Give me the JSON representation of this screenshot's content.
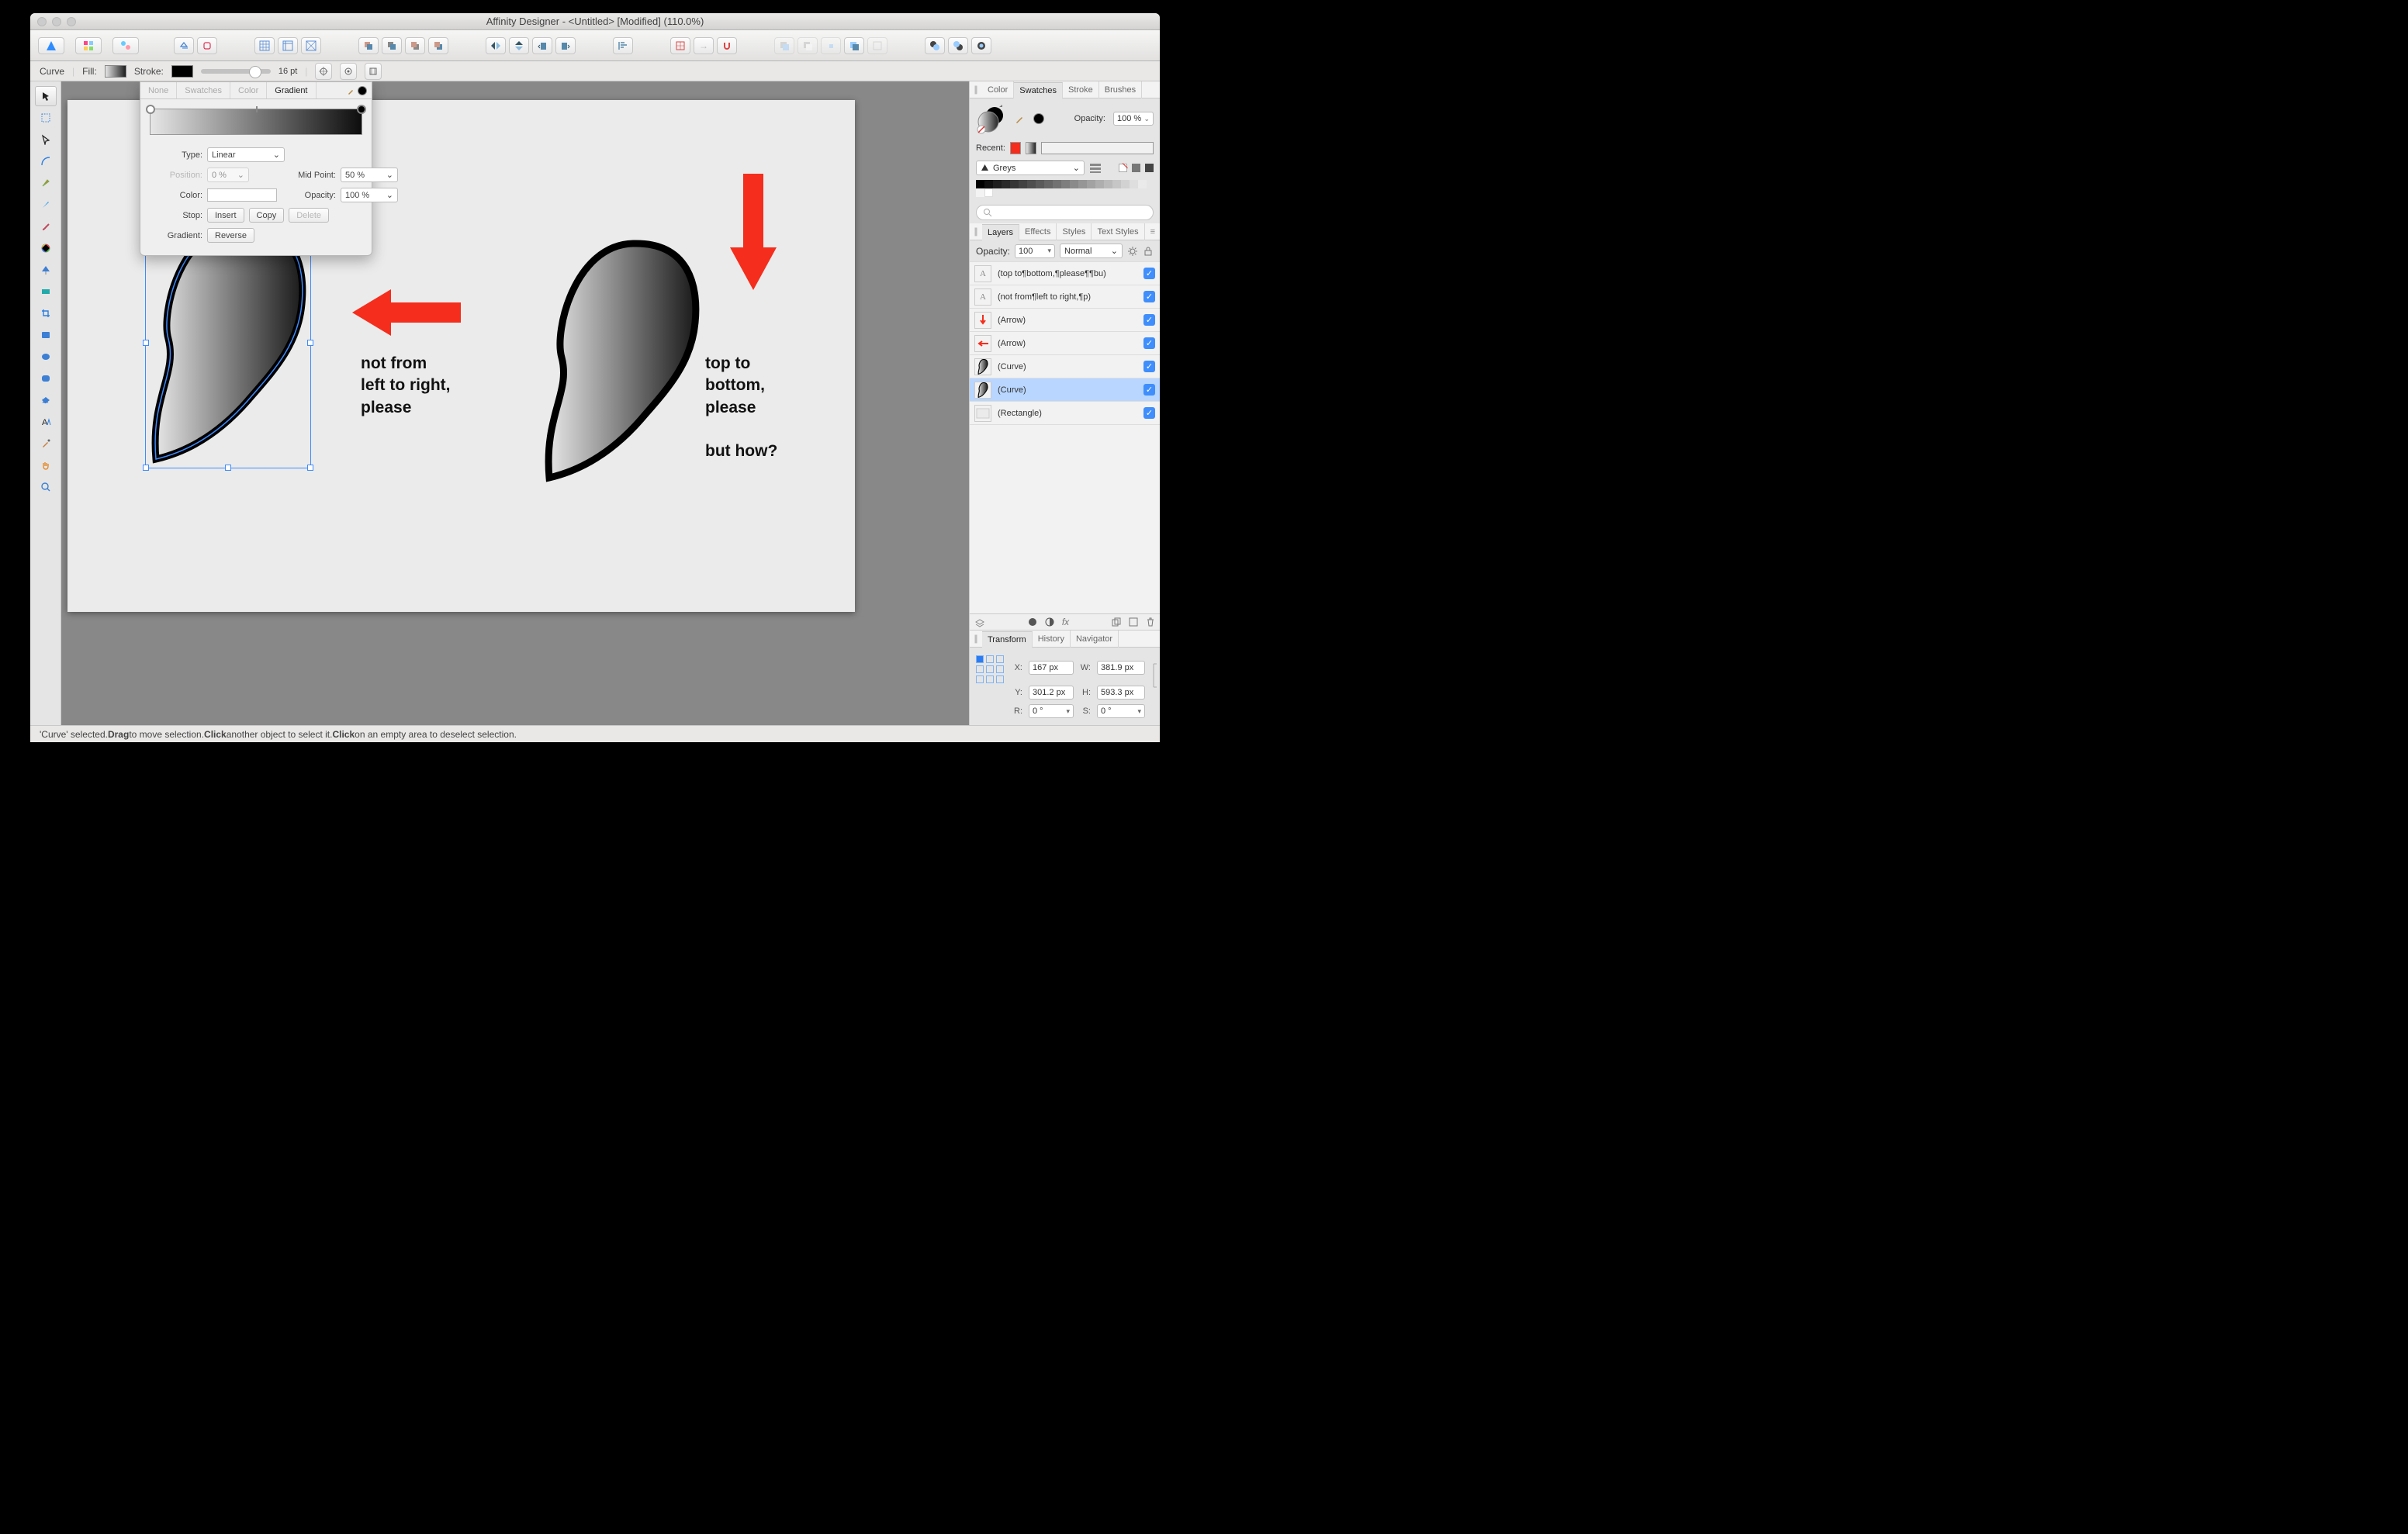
{
  "titlebar": {
    "title": "Affinity Designer - <Untitled> [Modified] (110.0%)"
  },
  "contextbar": {
    "object_label": "Curve",
    "fill_label": "Fill:",
    "stroke_label": "Stroke:",
    "stroke_size": "16 pt"
  },
  "gradient_popup": {
    "tabs": {
      "none": "None",
      "swatches": "Swatches",
      "color": "Color",
      "gradient": "Gradient"
    },
    "type_label": "Type:",
    "type_value": "Linear",
    "position_label": "Position:",
    "position_value": "0 %",
    "midpoint_label": "Mid Point:",
    "midpoint_value": "50 %",
    "color_label": "Color:",
    "opacity_label": "Opacity:",
    "opacity_value": "100 %",
    "stop_label": "Stop:",
    "insert": "Insert",
    "copy": "Copy",
    "delete": "Delete",
    "gradient_label": "Gradient:",
    "reverse": "Reverse"
  },
  "canvas": {
    "text_left_1": "not from",
    "text_left_2": "left to right,",
    "text_left_3": "please",
    "text_right_1": "top to",
    "text_right_2": "bottom,",
    "text_right_3": "please",
    "text_right_4": "but how?"
  },
  "right": {
    "color_tabs": {
      "color": "Color",
      "swatches": "Swatches",
      "stroke": "Stroke",
      "brushes": "Brushes"
    },
    "opacity_label": "Opacity:",
    "opacity_value": "100 %",
    "recent_label": "Recent:",
    "swatch_set": "Greys",
    "layers_tabs": {
      "layers": "Layers",
      "effects": "Effects",
      "styles": "Styles",
      "textstyles": "Text Styles"
    },
    "layer_opacity_label": "Opacity:",
    "layer_opacity_value": "100",
    "blend": "Normal",
    "layers": [
      {
        "name": "(top to¶bottom,¶please¶¶bu)",
        "type": "text"
      },
      {
        "name": "(not from¶left to right,¶p)",
        "type": "text"
      },
      {
        "name": "(Arrow)",
        "type": "arrow-v"
      },
      {
        "name": "(Arrow)",
        "type": "arrow-h"
      },
      {
        "name": "(Curve)",
        "type": "curve"
      },
      {
        "name": "(Curve)",
        "type": "curve",
        "selected": true
      },
      {
        "name": "(Rectangle)",
        "type": "rect"
      }
    ],
    "transform_tabs": {
      "transform": "Transform",
      "history": "History",
      "navigator": "Navigator"
    },
    "transform": {
      "x_label": "X:",
      "x": "167 px",
      "w_label": "W:",
      "w": "381.9 px",
      "y_label": "Y:",
      "y": "301.2 px",
      "h_label": "H:",
      "h": "593.3 px",
      "r_label": "R:",
      "r": "0 °",
      "s_label": "S:",
      "s": "0 °"
    }
  },
  "status": {
    "prefix": "'Curve' selected. ",
    "drag": "Drag",
    "drag_after": " to move selection. ",
    "click1": "Click",
    "click1_after": " another object to select it. ",
    "click2": "Click",
    "click2_after": " on an empty area to deselect selection."
  }
}
